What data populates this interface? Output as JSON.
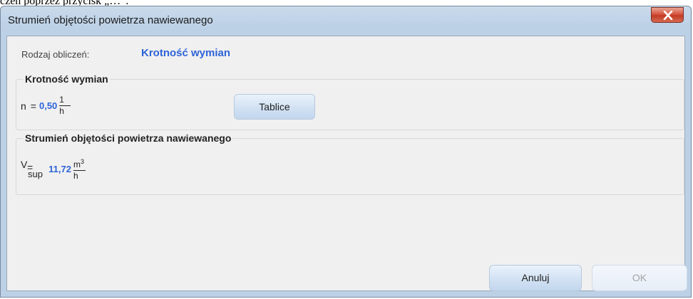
{
  "background_text": "czeń poprzez przycisk „…”.",
  "window": {
    "title": "Strumień objętości powietrza nawiewanego",
    "close_label": "×"
  },
  "calc_type": {
    "label": "Rodzaj obliczeń:",
    "value": "Krotność wymian"
  },
  "group_exchange": {
    "title": "Krotność wymian",
    "symbol": "n",
    "equals": "=",
    "value": "0,50",
    "unit_num": "1",
    "unit_den": "h",
    "button_label": "Tablice"
  },
  "group_flow": {
    "title": "Strumień objętości powietrza nawiewanego",
    "symbol": "V",
    "subscript": "sup",
    "equals": "=",
    "value": "11,72",
    "unit_num": "m",
    "unit_num_sup": "3",
    "unit_den": "h"
  },
  "buttons": {
    "cancel": "Anuluj",
    "ok": "OK"
  },
  "colors": {
    "accent": "#2d64d8",
    "close_red": "#c23b24"
  }
}
